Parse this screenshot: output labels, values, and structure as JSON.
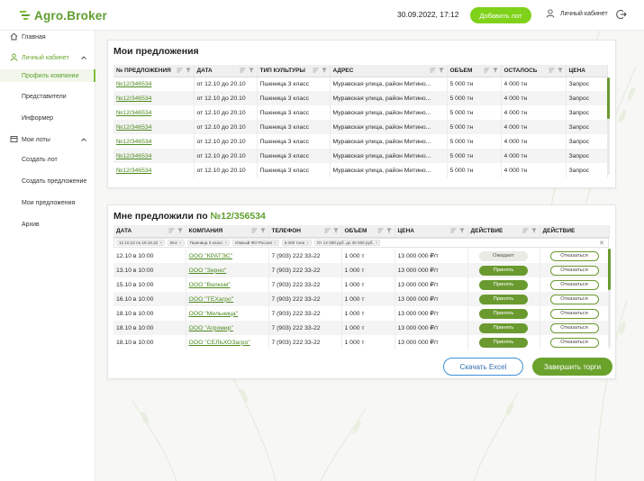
{
  "header": {
    "logo_text": "Agro.Broker",
    "datetime": "30.09.2022, 17:12",
    "add_lot_label": "Добавить лот",
    "account_label": "Личный кабинет"
  },
  "sidebar": {
    "items": [
      {
        "label": "Главная",
        "icon": "home-icon"
      },
      {
        "label": "Личный кабинет",
        "icon": "user-icon"
      },
      {
        "label": "Профиль компании"
      },
      {
        "label": "Представители"
      },
      {
        "label": "Информер"
      },
      {
        "label": "Мои лоты",
        "icon": "lots-icon"
      },
      {
        "label": "Создать лот"
      },
      {
        "label": "Создать предложение"
      },
      {
        "label": "Мои предложения"
      },
      {
        "label": "Архив"
      }
    ]
  },
  "my_offers": {
    "title": "Мои предложения",
    "columns": [
      "№ ПРЕДЛОЖЕНИЯ",
      "ДАТА",
      "ТИП КУЛЬТУРЫ",
      "АДРЕС",
      "ОБЪЕМ",
      "ОСТАЛОСЬ",
      "ЦЕНА"
    ],
    "rows": [
      [
        "№12/346534",
        "от 12.10 до 20.10",
        "Пшеница 3 класс",
        "Муравская улица, район Митино...",
        "5 000 тн",
        "4 000 тн",
        "Запрос"
      ],
      [
        "№12/346534",
        "от 12.10 до 20.10",
        "Пшеница 3 класс",
        "Муравская улица, район Митино...",
        "5 000 тн",
        "4 000 тн",
        "Запрос"
      ],
      [
        "№12/346534",
        "от 12.10 до 20.10",
        "Пшеница 3 класс",
        "Муравская улица, район Митино...",
        "5 000 тн",
        "4 000 тн",
        "Запрос"
      ],
      [
        "№12/346534",
        "от 12.10 до 20.10",
        "Пшеница 3 класс",
        "Муравская улица, район Митино...",
        "5 000 тн",
        "4 000 тн",
        "Запрос"
      ],
      [
        "№12/346534",
        "от 12.10 до 20.10",
        "Пшеница 3 класс",
        "Муравская улица, район Митино...",
        "5 000 тн",
        "4 000 тн",
        "Запрос"
      ],
      [
        "№12/346534",
        "от 12.10 до 20.10",
        "Пшеница 3 класс",
        "Муравская улица, район Митино...",
        "5 000 тн",
        "4 000 тн",
        "Запрос"
      ],
      [
        "№12/346534",
        "от 12.10 до 20.10",
        "Пшеница 3 класс",
        "Муравская улица, район Митино...",
        "5 000 тн",
        "4 000 тн",
        "Запрос"
      ]
    ]
  },
  "offered_to_me": {
    "title_prefix": "Мне предложили по",
    "title_number": "№12/356534",
    "columns": [
      "ДАТА",
      "КОМПАНИЯ",
      "ТЕЛЕФОН",
      "ОБЪЕМ",
      "ЦЕНА",
      "ДЕЙСТВИЕ",
      "ДЕЙСТВИЕ"
    ],
    "filters": [
      "12.10.22 по 19.10.22",
      "Все",
      "Пшеница 3 класс",
      "Южный ФО Россия",
      "5 000 тонн",
      "От 12 000 руб. до 30 000 руб."
    ],
    "rows": [
      {
        "date": "12.10 в 10:00",
        "company": "ООО \"КРАТЭС\"",
        "phone": "7 (903) 222 33-22",
        "volume": "1 000 т",
        "price": "13 000 000 ₽/т",
        "action": "Ожидает",
        "action_type": "wait",
        "decline": "Отказаться"
      },
      {
        "date": "13.10 в 10:00",
        "company": "ООО \"Зерно\"",
        "phone": "7 (903) 222 33-22",
        "volume": "1 000 т",
        "price": "13 000 000 ₽/т",
        "action": "Принять",
        "action_type": "accept",
        "decline": "Отказаться"
      },
      {
        "date": "15.10 в 10:00",
        "company": "ООО \"Велком\"",
        "phone": "7 (903) 222 33-22",
        "volume": "1 000 т",
        "price": "13 000 000 ₽/т",
        "action": "Принять",
        "action_type": "accept",
        "decline": "Отказаться"
      },
      {
        "date": "16.10 в 10:00",
        "company": "ООО \"ТЕХагро\"",
        "phone": "7 (903) 222 33-22",
        "volume": "1 000 т",
        "price": "13 000 000 ₽/т",
        "action": "Принять",
        "action_type": "accept",
        "decline": "Отказаться"
      },
      {
        "date": "18.10 в 10:00",
        "company": "ООО \"Мельница\"",
        "phone": "7 (903) 222 33-22",
        "volume": "1 000 т",
        "price": "13 000 000 ₽/т",
        "action": "Принять",
        "action_type": "accept",
        "decline": "Отказаться"
      },
      {
        "date": "18.10 в 10:00",
        "company": "ООО \"Агромир\"",
        "phone": "7 (903) 222 33-22",
        "volume": "1 000 т",
        "price": "13 000 000 ₽/т",
        "action": "Принять",
        "action_type": "accept",
        "decline": "Отказаться"
      },
      {
        "date": "18.10 в 10:00",
        "company": "ООО \"СЕЛЬХОЗагро\"",
        "phone": "7 (903) 222 33-22",
        "volume": "1 000 т",
        "price": "13 000 000 ₽/т",
        "action": "Принять",
        "action_type": "accept",
        "decline": "Отказаться"
      }
    ],
    "excel_label": "Скачать Excel",
    "finish_label": "Завершить торги"
  },
  "colors": {
    "brand_green": "#5f9e2e",
    "lime": "#7fd11a",
    "accept_green": "#6a9a2f",
    "excel_blue": "#3d8fd6"
  }
}
